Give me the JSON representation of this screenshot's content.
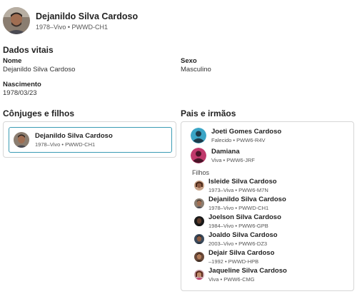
{
  "person": {
    "name": "Dejanildo Silva Cardoso",
    "summary": "1978–Vivo • PWWD-CH1"
  },
  "vitals": {
    "title": "Dados vitais",
    "name_label": "Nome",
    "name_value": "Dejanildo Silva Cardoso",
    "sex_label": "Sexo",
    "sex_value": "Masculino",
    "birth_label": "Nascimento",
    "birth_value": "1978/03/23"
  },
  "spouses": {
    "title": "Cônjuges e filhos",
    "card": {
      "name": "Dejanildo Silva Cardoso",
      "summary": "1978–Vivo • PWWD-CH1"
    }
  },
  "parents": {
    "title": "Pais e irmãos",
    "father": {
      "name": "Joeti Gomes Cardoso",
      "summary": "Falecido • PWW6-R4V"
    },
    "mother": {
      "name": "Damiana",
      "summary": "Viva • PWW6-JRF"
    },
    "children_label": "Filhos",
    "children": [
      {
        "name": "Isleide Silva Cardoso",
        "summary": "1973–Viva • PWW6-M7N"
      },
      {
        "name": "Dejanildo Silva Cardoso",
        "summary": "1978–Vivo • PWWD-CH1"
      },
      {
        "name": "Joelson Silva Cardoso",
        "summary": "1984–Vivo • PWW6-GPB"
      },
      {
        "name": "Joaldo Silva Cardoso",
        "summary": "2003–Vivo • PWW6-DZ3"
      },
      {
        "name": "Dejair Silva Cardoso",
        "summary": "–1992 • PWWD-HPB"
      },
      {
        "name": "Jaqueline Silva Cardoso",
        "summary": "Viva • PWW6-CMG"
      }
    ]
  },
  "colors": {
    "selected_border": "#3a9bb4",
    "male_icon": "#3aa5c6",
    "female_icon": "#c0396b"
  }
}
